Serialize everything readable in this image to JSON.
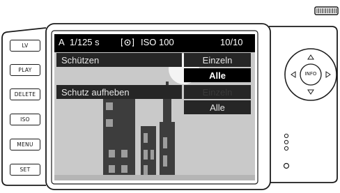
{
  "buttons": {
    "lv": "LV",
    "play": "PLAY",
    "delete": "DELETE",
    "iso": "ISO",
    "menu": "MENU",
    "set": "SET"
  },
  "status_bar": {
    "mode": "A",
    "shutter": "1/125 s",
    "iso": "ISO 100",
    "count": "10/10"
  },
  "menu": {
    "protect": "Schützen",
    "unprotect": "Schutz aufheben",
    "protect_options": [
      "Einzeln",
      "Alle"
    ],
    "unprotect_options": [
      "Einzeln",
      "Alle"
    ]
  },
  "dial": {
    "center": "INFO"
  },
  "colors": {
    "screen_bg": "#000000",
    "menu_bg": "#262626",
    "highlight_bg": "#000000",
    "text": "#e6e6e6",
    "disabled_text": "#3a3a3a"
  }
}
